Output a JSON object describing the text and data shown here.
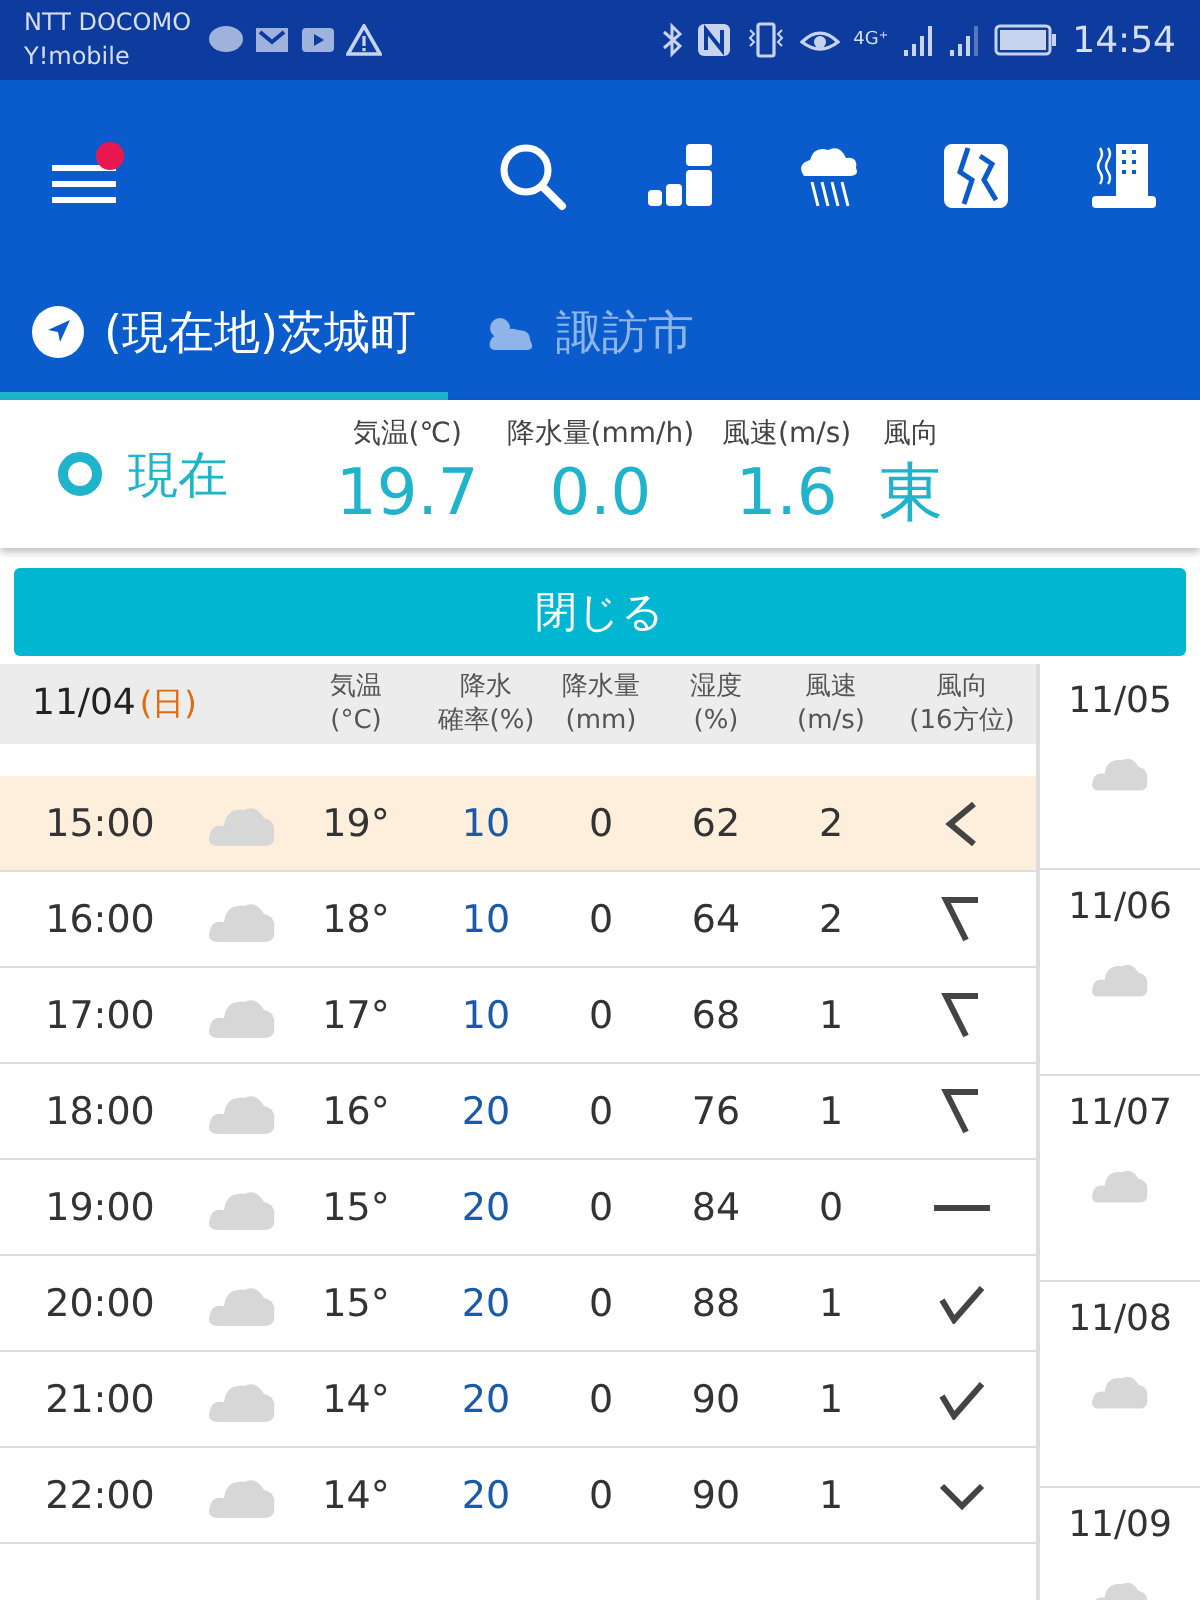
{
  "status_bar": {
    "carrier": "NTT DOCOMO",
    "carrier_2": "Y!mobile",
    "network": "4G⁺",
    "time": "14:54"
  },
  "tabs": [
    {
      "label": "(現在地)茨城町",
      "selected": true,
      "kind": "location"
    },
    {
      "label": "諏訪市",
      "selected": false,
      "kind": "weather"
    }
  ],
  "current": {
    "label": "現在",
    "metrics": [
      {
        "label": "気温(℃)",
        "value": "19.7"
      },
      {
        "label": "降水量(mm/h)",
        "value": "0.0"
      },
      {
        "label": "風速(m/s)",
        "value": "1.6"
      },
      {
        "label": "風向",
        "value": "東"
      }
    ]
  },
  "close_button": "閉じる",
  "table": {
    "date": "11/04",
    "weekday": "(日)",
    "columns": [
      {
        "line_1": "気温",
        "line_2": "(°C)"
      },
      {
        "line_1": "降水",
        "line_2": "確率(%)"
      },
      {
        "line_1": "降水量",
        "line_2": "(mm)"
      },
      {
        "line_1": "湿度",
        "line_2": "(%)"
      },
      {
        "line_1": "風速",
        "line_2": "(m/s)"
      },
      {
        "line_1": "風向",
        "line_2": "(16方位)"
      }
    ],
    "rows": [
      {
        "time": "15:00",
        "temp": "19°",
        "prob": "10",
        "rain": "0",
        "humidity": "62",
        "wind": "2",
        "kind": "w",
        "selected": true
      },
      {
        "time": "16:00",
        "temp": "18°",
        "prob": "10",
        "rain": "0",
        "humidity": "64",
        "wind": "2",
        "kind": "nw",
        "selected": false
      },
      {
        "time": "17:00",
        "temp": "17°",
        "prob": "10",
        "rain": "0",
        "humidity": "68",
        "wind": "1",
        "kind": "nw",
        "selected": false
      },
      {
        "time": "18:00",
        "temp": "16°",
        "prob": "20",
        "rain": "0",
        "humidity": "76",
        "wind": "1",
        "kind": "nw",
        "selected": false
      },
      {
        "time": "19:00",
        "temp": "15°",
        "prob": "20",
        "rain": "0",
        "humidity": "84",
        "wind": "0",
        "kind": "calm",
        "selected": false
      },
      {
        "time": "20:00",
        "temp": "15°",
        "prob": "20",
        "rain": "0",
        "humidity": "88",
        "wind": "1",
        "kind": "se",
        "selected": false
      },
      {
        "time": "21:00",
        "temp": "14°",
        "prob": "20",
        "rain": "0",
        "humidity": "90",
        "wind": "1",
        "kind": "se",
        "selected": false
      },
      {
        "time": "22:00",
        "temp": "14°",
        "prob": "20",
        "rain": "0",
        "humidity": "90",
        "wind": "1",
        "kind": "s",
        "selected": false
      }
    ]
  },
  "days": [
    {
      "date": "11/05"
    },
    {
      "date": "11/06"
    },
    {
      "date": "11/07"
    },
    {
      "date": "11/08"
    },
    {
      "date": "11/09"
    }
  ]
}
